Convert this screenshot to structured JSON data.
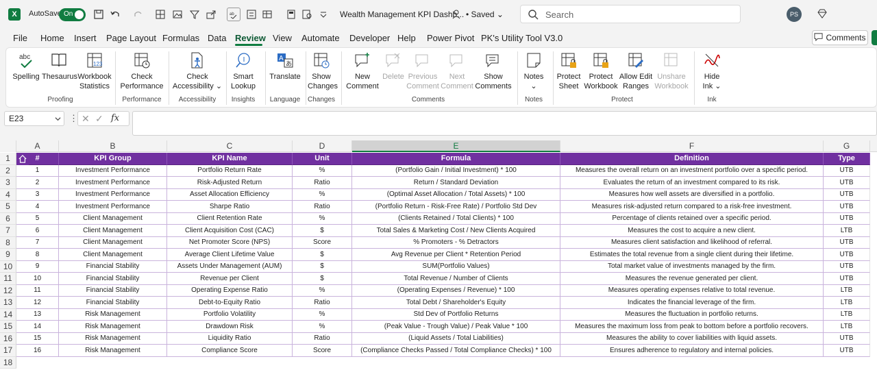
{
  "app": {
    "autosave_label": "AutoSave",
    "autosave_state": "On",
    "doc_title": "Wealth Management KPI Dashb...",
    "saved_status": "• Saved",
    "search_placeholder": "Search",
    "user_initials": "PS"
  },
  "menu": {
    "tabs": [
      "File",
      "Home",
      "Insert",
      "Page Layout",
      "Formulas",
      "Data",
      "Review",
      "View",
      "Automate",
      "Developer",
      "Help",
      "Power Pivot",
      "PK's Utility Tool V3.0"
    ],
    "active": "Review",
    "comments_button": "Comments"
  },
  "ribbon": {
    "buttons": [
      {
        "label1": "Spelling",
        "label2": "",
        "icon": "abc-check-icon",
        "disabled": false
      },
      {
        "label1": "Thesaurus",
        "label2": "",
        "icon": "book-icon",
        "disabled": false
      },
      {
        "label1": "Workbook",
        "label2": "Statistics",
        "icon": "workbook-stats-icon",
        "disabled": false
      },
      {
        "label1": "Check",
        "label2": "Performance",
        "icon": "check-performance-icon",
        "disabled": false
      },
      {
        "label1": "Check",
        "label2": "Accessibility ⌄",
        "icon": "accessibility-icon",
        "disabled": false
      },
      {
        "label1": "Smart",
        "label2": "Lookup",
        "icon": "smart-lookup-icon",
        "disabled": false
      },
      {
        "label1": "Translate",
        "label2": "",
        "icon": "translate-icon",
        "disabled": false
      },
      {
        "label1": "Show",
        "label2": "Changes",
        "icon": "show-changes-icon",
        "disabled": false
      },
      {
        "label1": "New",
        "label2": "Comment",
        "icon": "new-comment-icon",
        "disabled": false
      },
      {
        "label1": "Delete",
        "label2": "",
        "icon": "delete-comment-icon",
        "disabled": true
      },
      {
        "label1": "Previous",
        "label2": "Comment",
        "icon": "previous-comment-icon",
        "disabled": true
      },
      {
        "label1": "Next",
        "label2": "Comment",
        "icon": "next-comment-icon",
        "disabled": true
      },
      {
        "label1": "Show",
        "label2": "Comments",
        "icon": "show-comments-icon",
        "disabled": false
      },
      {
        "label1": "Notes",
        "label2": "⌄",
        "icon": "notes-icon",
        "disabled": false
      },
      {
        "label1": "Protect",
        "label2": "Sheet",
        "icon": "protect-sheet-icon",
        "disabled": false
      },
      {
        "label1": "Protect",
        "label2": "Workbook",
        "icon": "protect-workbook-icon",
        "disabled": false
      },
      {
        "label1": "Allow Edit",
        "label2": "Ranges",
        "icon": "allow-edit-ranges-icon",
        "disabled": false
      },
      {
        "label1": "Unshare",
        "label2": "Workbook",
        "icon": "unshare-workbook-icon",
        "disabled": true
      },
      {
        "label1": "Hide",
        "label2": "Ink ⌄",
        "icon": "hide-ink-icon",
        "disabled": false
      }
    ],
    "groups": [
      "Proofing",
      "Performance",
      "Accessibility",
      "Insights",
      "Language",
      "Changes",
      "Comments",
      "Notes",
      "Protect",
      "Ink"
    ]
  },
  "formula_bar": {
    "name_box": "E23",
    "fx": "fx",
    "value": ""
  },
  "sheet": {
    "column_letters": [
      "A",
      "B",
      "C",
      "D",
      "E",
      "F",
      "G"
    ],
    "selected_column": "E",
    "row_numbers": [
      "1",
      "2",
      "3",
      "4",
      "5",
      "6",
      "7",
      "8",
      "9",
      "10",
      "11",
      "12",
      "13",
      "14",
      "15",
      "16",
      "17",
      "18"
    ],
    "header": [
      "#",
      "KPI Group",
      "KPI Name",
      "Unit",
      "Formula",
      "Definition",
      "Type"
    ],
    "header_color": "#7030a0",
    "rows": [
      [
        "1",
        "Investment Performance",
        "Portfolio Return Rate",
        "%",
        "(Portfolio Gain / Initial Investment) * 100",
        "Measures the overall return on an investment portfolio over a specific period.",
        "UTB"
      ],
      [
        "2",
        "Investment Performance",
        "Risk-Adjusted Return",
        "Ratio",
        "Return / Standard Deviation",
        "Evaluates the return of an investment compared to its risk.",
        "UTB"
      ],
      [
        "3",
        "Investment Performance",
        "Asset Allocation Efficiency",
        "%",
        "(Optimal Asset Allocation / Total Assets) * 100",
        "Measures how well assets are diversified in a portfolio.",
        "UTB"
      ],
      [
        "4",
        "Investment Performance",
        "Sharpe Ratio",
        "Ratio",
        "(Portfolio Return - Risk-Free Rate) / Portfolio Std Dev",
        "Measures risk-adjusted return compared to a risk-free investment.",
        "UTB"
      ],
      [
        "5",
        "Client Management",
        "Client Retention Rate",
        "%",
        "(Clients Retained / Total Clients) * 100",
        "Percentage of clients retained over a specific period.",
        "UTB"
      ],
      [
        "6",
        "Client Management",
        "Client Acquisition Cost (CAC)",
        "$",
        "Total Sales & Marketing Cost / New Clients Acquired",
        "Measures the cost to acquire a new client.",
        "LTB"
      ],
      [
        "7",
        "Client Management",
        "Net Promoter Score (NPS)",
        "Score",
        "% Promoters - % Detractors",
        "Measures client satisfaction and likelihood of referral.",
        "UTB"
      ],
      [
        "8",
        "Client Management",
        "Average Client Lifetime Value",
        "$",
        "Avg Revenue per Client * Retention Period",
        "Estimates the total revenue from a single client during their lifetime.",
        "UTB"
      ],
      [
        "9",
        "Financial Stability",
        "Assets Under Management (AUM)",
        "$",
        "SUM(Portfolio Values)",
        "Total market value of investments managed by the firm.",
        "UTB"
      ],
      [
        "10",
        "Financial Stability",
        "Revenue per Client",
        "$",
        "Total Revenue / Number of Clients",
        "Measures the revenue generated per client.",
        "UTB"
      ],
      [
        "11",
        "Financial Stability",
        "Operating Expense Ratio",
        "%",
        "(Operating Expenses / Revenue) * 100",
        "Measures operating expenses relative to total revenue.",
        "LTB"
      ],
      [
        "12",
        "Financial Stability",
        "Debt-to-Equity Ratio",
        "Ratio",
        "Total Debt / Shareholder's Equity",
        "Indicates the financial leverage of the firm.",
        "LTB"
      ],
      [
        "13",
        "Risk Management",
        "Portfolio Volatility",
        "%",
        "Std Dev of Portfolio Returns",
        "Measures the fluctuation in portfolio returns.",
        "LTB"
      ],
      [
        "14",
        "Risk Management",
        "Drawdown Risk",
        "%",
        "(Peak Value - Trough Value) / Peak Value * 100",
        "Measures the maximum loss from peak to bottom before a portfolio recovers.",
        "LTB"
      ],
      [
        "15",
        "Risk Management",
        "Liquidity Ratio",
        "Ratio",
        "(Liquid Assets / Total Liabilities)",
        "Measures the ability to cover liabilities with liquid assets.",
        "UTB"
      ],
      [
        "16",
        "Risk Management",
        "Compliance Score",
        "Score",
        "(Compliance Checks Passed / Total Compliance Checks) * 100",
        "Ensures adherence to regulatory and internal policies.",
        "UTB"
      ]
    ]
  }
}
